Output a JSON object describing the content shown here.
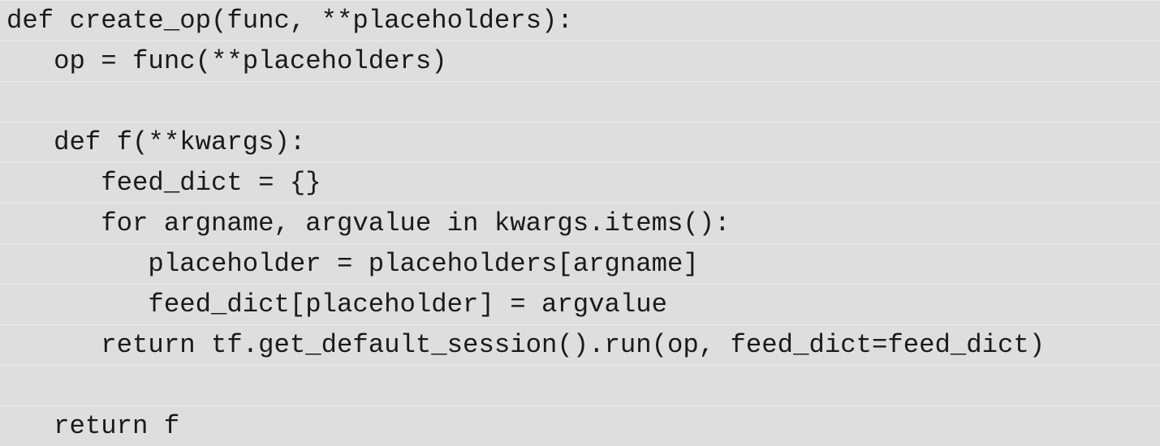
{
  "code": {
    "lines": [
      "def create_op(func, **placeholders):",
      "   op = func(**placeholders)",
      "",
      "   def f(**kwargs):",
      "      feed_dict = {}",
      "      for argname, argvalue in kwargs.items():",
      "         placeholder = placeholders[argname]",
      "         feed_dict[placeholder] = argvalue",
      "      return tf.get_default_session().run(op, feed_dict=feed_dict)",
      "",
      "   return f"
    ]
  }
}
